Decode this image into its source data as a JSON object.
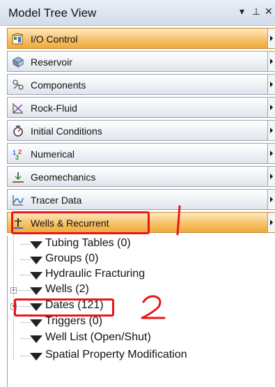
{
  "panel": {
    "title": "Model Tree View",
    "controls": {
      "dropdown": "▾",
      "pin": "⊥",
      "close": "✕"
    }
  },
  "sections": [
    {
      "label": "I/O Control",
      "icon": "io-control-icon",
      "active": true
    },
    {
      "label": "Reservoir",
      "icon": "reservoir-icon",
      "active": false
    },
    {
      "label": "Components",
      "icon": "components-icon",
      "active": false
    },
    {
      "label": "Rock-Fluid",
      "icon": "rock-fluid-icon",
      "active": false
    },
    {
      "label": "Initial Conditions",
      "icon": "initial-conditions-icon",
      "active": false
    },
    {
      "label": "Numerical",
      "icon": "numerical-icon",
      "active": false
    },
    {
      "label": "Geomechanics",
      "icon": "geomechanics-icon",
      "active": false
    },
    {
      "label": "Tracer Data",
      "icon": "tracer-data-icon",
      "active": false
    },
    {
      "label": "Wells & Recurrent",
      "icon": "wells-recurrent-icon",
      "active": true
    }
  ],
  "tree_items": [
    {
      "label": "Tubing Tables (0)",
      "expandable": false
    },
    {
      "label": "Groups (0)",
      "expandable": false
    },
    {
      "label": "Hydraulic Fracturing",
      "expandable": false
    },
    {
      "label": "Wells (2)",
      "expandable": true
    },
    {
      "label": "Dates (121)",
      "expandable": true
    },
    {
      "label": "Triggers (0)",
      "expandable": false
    },
    {
      "label": "Well List (Open/Shut)",
      "expandable": false
    },
    {
      "label": "Spatial Property Modification",
      "expandable": false
    }
  ],
  "annotations": {
    "first": "1",
    "second": "2"
  },
  "colors": {
    "active_section": "#f4b350",
    "annotation": "#e8161a"
  }
}
